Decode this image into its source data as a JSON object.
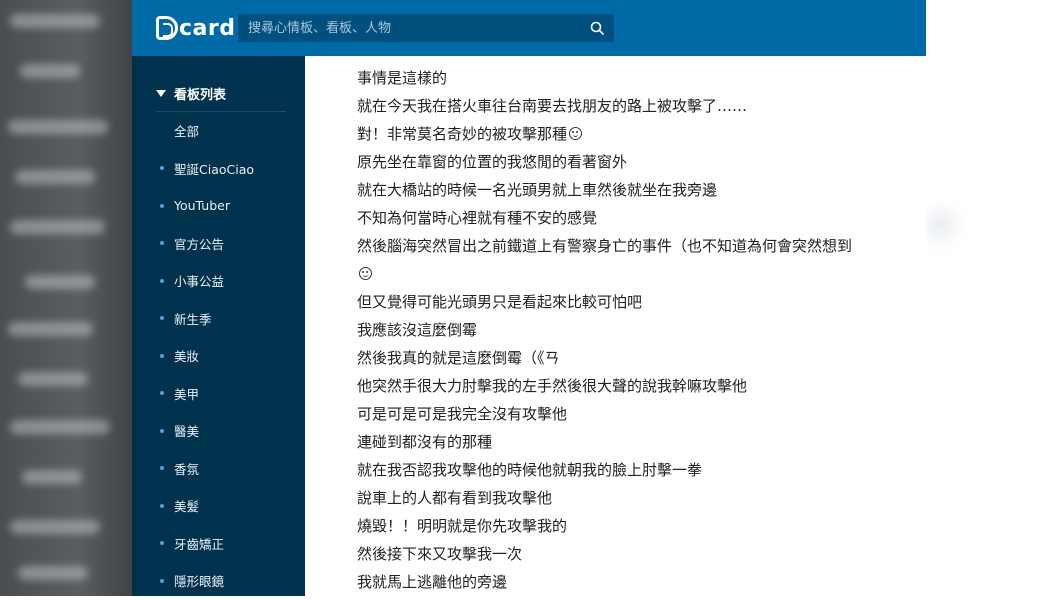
{
  "header": {
    "logo_text": "card",
    "search_placeholder": "搜尋心情板、看板、人物"
  },
  "sidebar": {
    "title": "看板列表",
    "items": [
      {
        "label": "全部",
        "dot": false
      },
      {
        "label": "聖誕CiaoCiao",
        "dot": true
      },
      {
        "label": "YouTuber",
        "dot": true
      },
      {
        "label": "官方公告",
        "dot": true
      },
      {
        "label": "小事公益",
        "dot": true
      },
      {
        "label": "新生季",
        "dot": true
      },
      {
        "label": "美妝",
        "dot": true
      },
      {
        "label": "美甲",
        "dot": true
      },
      {
        "label": "醫美",
        "dot": true
      },
      {
        "label": "香氛",
        "dot": true
      },
      {
        "label": "美髮",
        "dot": true
      },
      {
        "label": "牙齒矯正",
        "dot": true
      },
      {
        "label": "隱形眼鏡",
        "dot": true
      }
    ]
  },
  "post": {
    "lines": [
      {
        "text": "事情是這樣的",
        "emoji": ""
      },
      {
        "text": "就在今天我在搭火車往台南要去找朋友的路上被攻擊了……",
        "emoji": ""
      },
      {
        "text": "對！非常莫名奇妙的被攻擊那種",
        "emoji": "frown-emoji"
      },
      {
        "text": "原先坐在靠窗的位置的我悠閒的看著窗外",
        "emoji": ""
      },
      {
        "text": "就在大橋站的時候一名光頭男就上車然後就坐在我旁邊",
        "emoji": ""
      },
      {
        "text": "不知為何當時心裡就有種不安的感覺",
        "emoji": ""
      },
      {
        "text": "然後腦海突然冒出之前鐵道上有警察身亡的事件（也不知道為何會突然想到",
        "emoji": ""
      },
      {
        "text": "",
        "emoji": "smile-emoji"
      },
      {
        "text": "但又覺得可能光頭男只是看起來比較可怕吧",
        "emoji": ""
      },
      {
        "text": "我應該沒這麼倒霉",
        "emoji": ""
      },
      {
        "text": "然後我真的就是這麼倒霉（《ㄢ",
        "emoji": ""
      },
      {
        "text": "他突然手很大力肘擊我的左手然後很大聲的說我幹嘛攻擊他",
        "emoji": ""
      },
      {
        "text": "可是可是可是我完全沒有攻擊他",
        "emoji": ""
      },
      {
        "text": "連碰到都沒有的那種",
        "emoji": ""
      },
      {
        "text": "就在我否認我攻擊他的時候他就朝我的臉上肘擊一拳",
        "emoji": ""
      },
      {
        "text": "說車上的人都有看到我攻擊他",
        "emoji": ""
      },
      {
        "text": "燒毀！！明明就是你先攻擊我的",
        "emoji": ""
      },
      {
        "text": "然後接下來又攻擊我一次",
        "emoji": ""
      },
      {
        "text": "我就馬上逃離他的旁邊",
        "emoji": ""
      }
    ]
  },
  "colors": {
    "header_bg": "#006aa6",
    "sidebar_bg": "#00324e",
    "dot": "#4da3d6"
  }
}
